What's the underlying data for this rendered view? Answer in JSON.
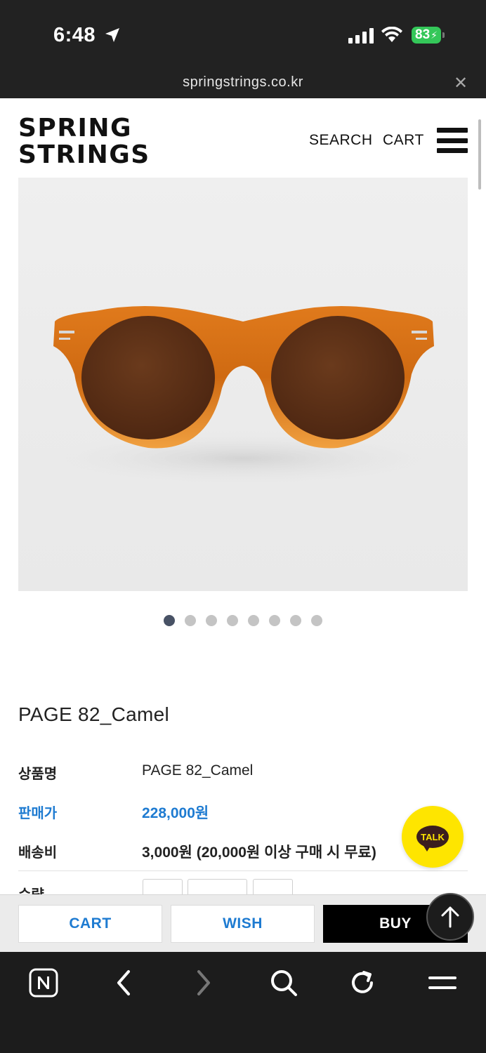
{
  "status_bar": {
    "time": "6:48",
    "battery": "83"
  },
  "browser": {
    "url": "springstrings.co.kr"
  },
  "header": {
    "logo_line1": "SPRING",
    "logo_line2": "STRINGS",
    "search_label": "SEARCH",
    "cart_label": "CART"
  },
  "gallery": {
    "total_slides": 8,
    "active_index": 0,
    "image_subject": "amber-round-sunglasses"
  },
  "product": {
    "title": "PAGE 82_Camel",
    "rows": [
      {
        "label": "상품명",
        "value": "PAGE 82_Camel"
      },
      {
        "label": "판매가",
        "value": "228,000원"
      },
      {
        "label": "배송비",
        "value": "3,000원 (20,000원 이상 구매 시 무료)"
      },
      {
        "label": "수량",
        "value": ""
      }
    ]
  },
  "kakao": {
    "label": "TALK"
  },
  "actions": {
    "cart": "CART",
    "wish": "WISH",
    "buy": "BUY"
  },
  "toolbar": {
    "icons": [
      "naver-home-icon",
      "back-icon",
      "forward-icon",
      "search-icon",
      "reload-icon",
      "menu-icon"
    ]
  },
  "colors": {
    "accent_blue": "#1e7bd1",
    "kakao_yellow": "#fee500",
    "battery_green": "#34c759",
    "active_dot": "#485265"
  }
}
